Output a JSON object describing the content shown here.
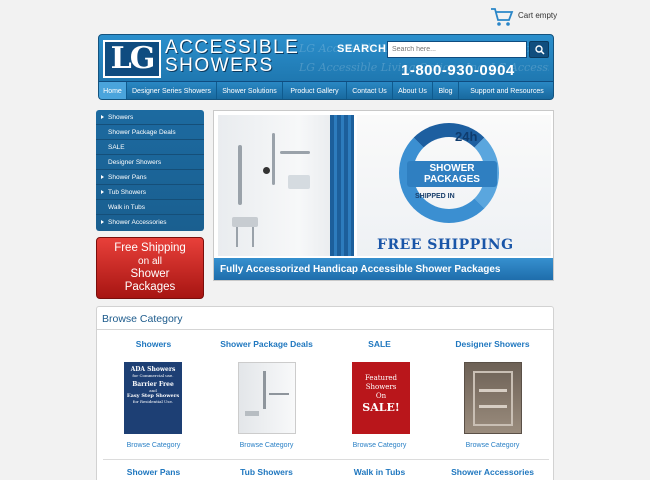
{
  "cart": {
    "label": "Cart empty"
  },
  "header": {
    "logo_initials": "LG",
    "logo_line1": "ACCESSIBLE",
    "logo_line2": "SHOWERS",
    "watermark": "LG Accessible Living Options Inc. LG Accessible Living Options Inc.",
    "search_label": "SEARCH",
    "search_placeholder": "Search here...",
    "phone": "1-800-930-0904"
  },
  "nav": {
    "items": [
      {
        "label": "Home",
        "active": true
      },
      {
        "label": "Designer Series Showers"
      },
      {
        "label": "Shower Solutions"
      },
      {
        "label": "Product Gallery"
      },
      {
        "label": "Contact Us"
      },
      {
        "label": "About Us"
      },
      {
        "label": "Blog"
      },
      {
        "label": "Support and Resources"
      }
    ]
  },
  "sidebar": {
    "items": [
      {
        "label": "Showers",
        "arrow": true
      },
      {
        "label": "Shower Package Deals",
        "arrow": false
      },
      {
        "label": "SALE",
        "arrow": false
      },
      {
        "label": "Designer Showers",
        "arrow": false
      },
      {
        "label": "Shower Pans",
        "arrow": true
      },
      {
        "label": "Tub Showers",
        "arrow": true
      },
      {
        "label": "Walk in Tubs",
        "arrow": false
      },
      {
        "label": "Shower Accessories",
        "arrow": true
      }
    ]
  },
  "promo": {
    "line1": "Free Shipping",
    "line2": "on all",
    "line3": "Shower",
    "line4": "Packages"
  },
  "hero": {
    "badge": "24h",
    "pkg_line1": "SHOWER",
    "pkg_line2": "PACKAGES",
    "shipped": "SHIPPED IN",
    "free_shipping": "FREE SHIPPING",
    "caption": "Fully Accessorized Handicap Accessible Shower Packages"
  },
  "browse": {
    "title": "Browse Category",
    "link_label": "Browse Category",
    "row1": [
      {
        "title": "Showers",
        "thumb": "ada"
      },
      {
        "title": "Shower Package Deals",
        "thumb": "package"
      },
      {
        "title": "SALE",
        "thumb": "sale"
      },
      {
        "title": "Designer Showers",
        "thumb": "designer"
      }
    ],
    "row2": [
      {
        "title": "Shower Pans"
      },
      {
        "title": "Tub Showers"
      },
      {
        "title": "Walk in Tubs"
      },
      {
        "title": "Shower Accessories"
      }
    ],
    "thumb_ada": {
      "line1": "ADA Showers",
      "line2": "for Commercial use.",
      "line3": "Barrier Free",
      "line4": "and",
      "line5": "Easy Step Showers",
      "line6": "for Residential Use."
    },
    "thumb_sale": {
      "line1": "Featured",
      "line2": "Showers",
      "line3": "On",
      "line4": "SALE!"
    }
  },
  "colors": {
    "brand_blue": "#1a6fa6",
    "promo_red": "#c4201c",
    "link_blue": "#1f77bf"
  }
}
